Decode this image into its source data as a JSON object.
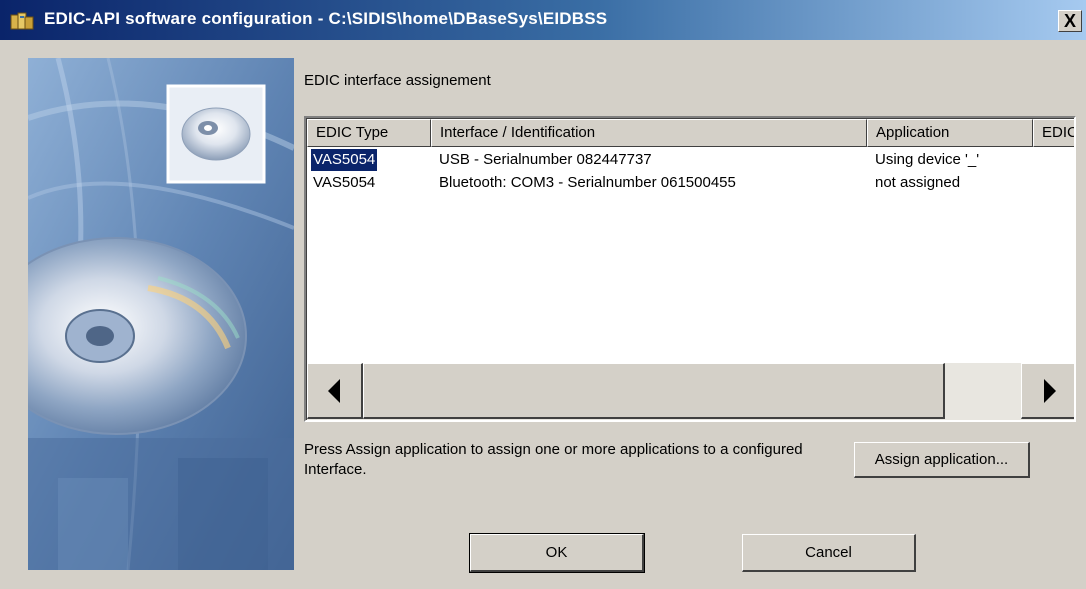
{
  "window": {
    "title": "EDIC-API software configuration - C:\\SIDIS\\home\\DBaseSys\\EIDBSS",
    "close_glyph": "X"
  },
  "section_label": "EDIC interface assignement",
  "table": {
    "columns": [
      "EDIC Type",
      "Interface / Identification",
      "Application",
      "EDIC"
    ],
    "rows": [
      {
        "edic_type": "VAS5054",
        "interface": "USB - Serialnumber 082447737",
        "application": "Using device '_'",
        "selected": true
      },
      {
        "edic_type": "VAS5054",
        "interface": "Bluetooth: COM3 - Serialnumber 061500455",
        "application": "not assigned",
        "selected": false
      }
    ]
  },
  "help_text": "Press Assign application to assign one or more applications to a configured Interface.",
  "buttons": {
    "assign": "Assign application...",
    "ok": "OK",
    "cancel": "Cancel"
  },
  "icons": {
    "title": "app-icon",
    "side": "cd-disc-illustration",
    "scroll_left": "arrow-left-icon",
    "scroll_right": "arrow-right-icon"
  },
  "colors": {
    "title_bar": "#0a246a",
    "selection": "#0a246a",
    "face": "#d4d0c8"
  }
}
